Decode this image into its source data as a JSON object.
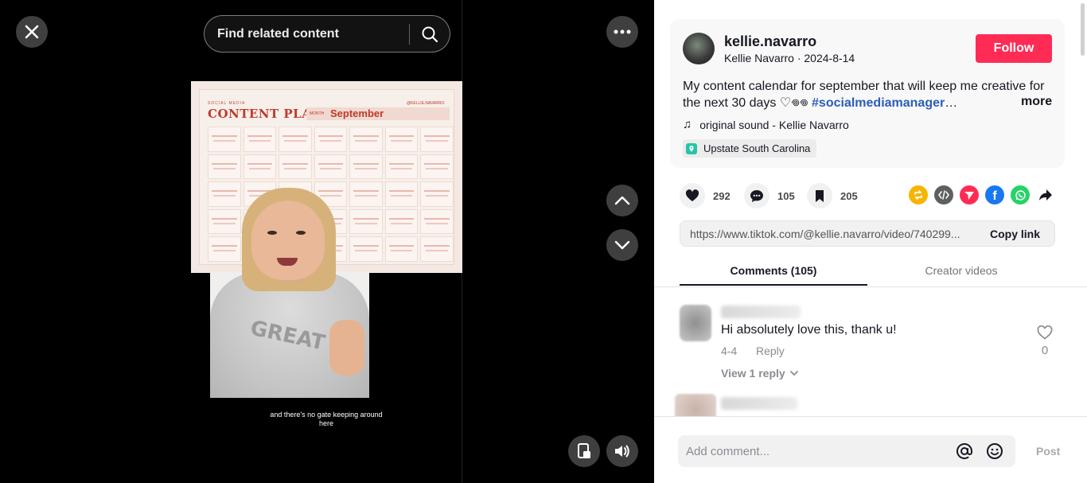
{
  "video": {
    "search_placeholder": "Find related content",
    "caption": "and there's no gate keeping around here",
    "calendar": {
      "small_label": "SOCIAL MEDIA",
      "title": "CONTENT PLAN",
      "month_label": "MONTH",
      "month": "September",
      "handle": "@KELLIE.NAVARRO"
    },
    "sweater_text": "GREAT"
  },
  "post": {
    "username": "kellie.navarro",
    "display_name": "Kellie Navarro",
    "separator": " · ",
    "date": "2024-8-14",
    "follow_label": "Follow",
    "description": "My content calendar for september that will keep me creative for the next 30 days ♡𖦹𖦹 ",
    "hashtag": "#socialmediamanager",
    "hashtag_suffix": "…",
    "more_label": "more",
    "sound": "original sound - Kellie Navarro",
    "location": "Upstate South Carolina"
  },
  "actions": {
    "likes": "292",
    "comments": "105",
    "saves": "205"
  },
  "share_link": {
    "url": "https://www.tiktok.com/@kellie.navarro/video/740299...",
    "copy_label": "Copy link"
  },
  "tabs": {
    "comments": "Comments (105)",
    "creator_videos": "Creator videos"
  },
  "comments": [
    {
      "text": "Hi absolutely love this, thank u!",
      "date": "4-4",
      "reply_label": "Reply",
      "view_replies": "View 1 reply",
      "likes": "0"
    }
  ],
  "comment_bar": {
    "placeholder": "Add comment...",
    "post_label": "Post"
  },
  "colors": {
    "follow": "#fe2c55",
    "hashtag": "#2b5db9",
    "calendar_accent": "#c0392b",
    "share_repost": "#f7b500",
    "share_embed": "#5f5f61",
    "share_dm": "#fe2c55",
    "share_facebook": "#1877f2",
    "share_whatsapp": "#25d366"
  }
}
